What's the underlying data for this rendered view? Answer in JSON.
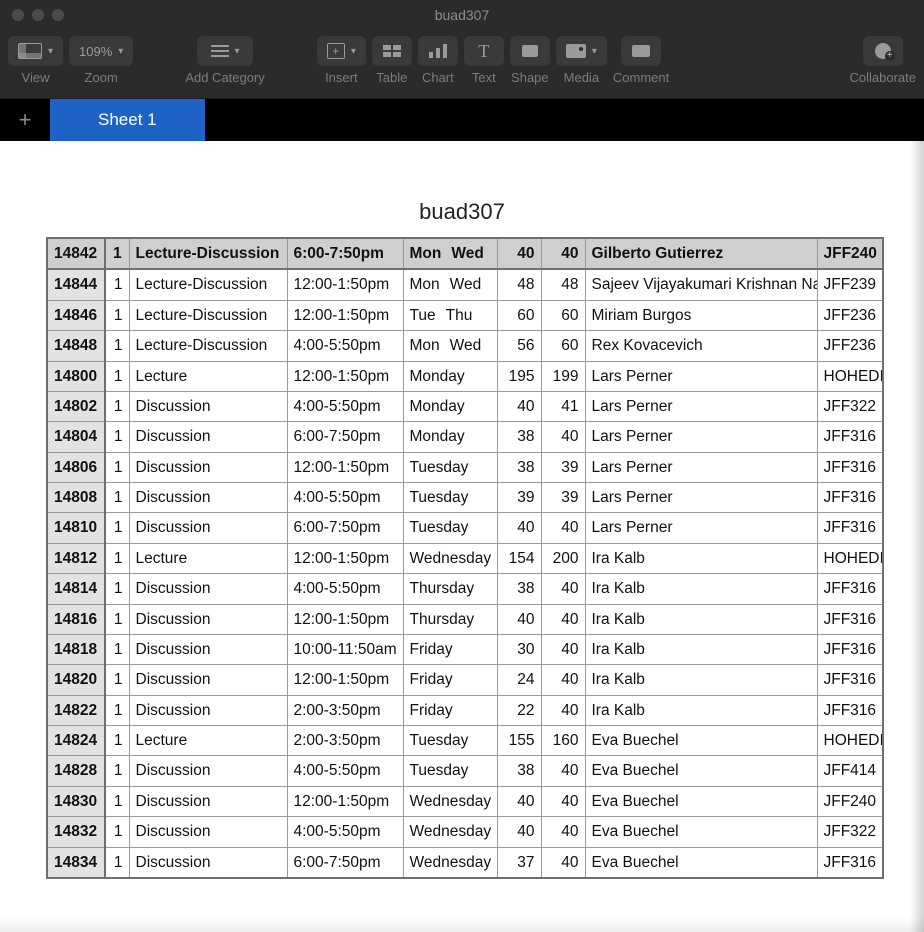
{
  "window": {
    "title": "buad307"
  },
  "toolbar": {
    "view": {
      "label": "View"
    },
    "zoom": {
      "label": "Zoom",
      "value": "109%"
    },
    "add_cat": {
      "label": "Add Category"
    },
    "insert": {
      "label": "Insert"
    },
    "table": {
      "label": "Table"
    },
    "chart": {
      "label": "Chart"
    },
    "text": {
      "label": "Text"
    },
    "shape": {
      "label": "Shape"
    },
    "media": {
      "label": "Media"
    },
    "comment": {
      "label": "Comment"
    },
    "collab": {
      "label": "Collaborate"
    }
  },
  "tabs": {
    "add_glyph": "+",
    "active": "Sheet 1"
  },
  "sheet": {
    "title": "buad307",
    "header": {
      "id": "14842",
      "sec": "1",
      "type": "Lecture-Discussion",
      "time": "6:00-7:50pm",
      "days": [
        "Mon",
        "Wed"
      ],
      "n1": "40",
      "n2": "40",
      "instructor": "Gilberto Gutierrez",
      "room": "JFF240"
    },
    "rows": [
      {
        "id": "14844",
        "sec": "1",
        "type": "Lecture-Discussion",
        "time": "12:00-1:50pm",
        "days": [
          "Mon",
          "Wed"
        ],
        "n1": "48",
        "n2": "48",
        "instructor": "Sajeev Vijayakumari Krishnan Nair",
        "room": "JFF239"
      },
      {
        "id": "14846",
        "sec": "1",
        "type": "Lecture-Discussion",
        "time": "12:00-1:50pm",
        "days": [
          "Tue",
          "Thu"
        ],
        "n1": "60",
        "n2": "60",
        "instructor": "Miriam Burgos",
        "room": "JFF236"
      },
      {
        "id": "14848",
        "sec": "1",
        "type": "Lecture-Discussion",
        "time": "4:00-5:50pm",
        "days": [
          "Mon",
          "Wed"
        ],
        "n1": "56",
        "n2": "60",
        "instructor": "Rex Kovacevich",
        "room": "JFF236"
      },
      {
        "id": "14800",
        "sec": "1",
        "type": "Lecture",
        "time": "12:00-1:50pm",
        "days": [
          "Monday"
        ],
        "n1": "195",
        "n2": "199",
        "instructor": "Lars Perner",
        "room": "HOHEDI"
      },
      {
        "id": "14802",
        "sec": "1",
        "type": "Discussion",
        "time": "4:00-5:50pm",
        "days": [
          "Monday"
        ],
        "n1": "40",
        "n2": "41",
        "instructor": "Lars Perner",
        "room": "JFF322"
      },
      {
        "id": "14804",
        "sec": "1",
        "type": "Discussion",
        "time": "6:00-7:50pm",
        "days": [
          "Monday"
        ],
        "n1": "38",
        "n2": "40",
        "instructor": "Lars Perner",
        "room": "JFF316"
      },
      {
        "id": "14806",
        "sec": "1",
        "type": "Discussion",
        "time": "12:00-1:50pm",
        "days": [
          "Tuesday"
        ],
        "n1": "38",
        "n2": "39",
        "instructor": "Lars Perner",
        "room": "JFF316"
      },
      {
        "id": "14808",
        "sec": "1",
        "type": "Discussion",
        "time": "4:00-5:50pm",
        "days": [
          "Tuesday"
        ],
        "n1": "39",
        "n2": "39",
        "instructor": "Lars Perner",
        "room": "JFF316"
      },
      {
        "id": "14810",
        "sec": "1",
        "type": "Discussion",
        "time": "6:00-7:50pm",
        "days": [
          "Tuesday"
        ],
        "n1": "40",
        "n2": "40",
        "instructor": "Lars Perner",
        "room": "JFF316"
      },
      {
        "id": "14812",
        "sec": "1",
        "type": "Lecture",
        "time": "12:00-1:50pm",
        "days": [
          "Wednesday"
        ],
        "n1": "154",
        "n2": "200",
        "instructor": "Ira Kalb",
        "room": "HOHEDI"
      },
      {
        "id": "14814",
        "sec": "1",
        "type": "Discussion",
        "time": "4:00-5:50pm",
        "days": [
          "Thursday"
        ],
        "n1": "38",
        "n2": "40",
        "instructor": "Ira Kalb",
        "room": "JFF316"
      },
      {
        "id": "14816",
        "sec": "1",
        "type": "Discussion",
        "time": "12:00-1:50pm",
        "days": [
          "Thursday"
        ],
        "n1": "40",
        "n2": "40",
        "instructor": "Ira Kalb",
        "room": "JFF316"
      },
      {
        "id": "14818",
        "sec": "1",
        "type": "Discussion",
        "time": "10:00-11:50am",
        "days": [
          "Friday"
        ],
        "n1": "30",
        "n2": "40",
        "instructor": "Ira Kalb",
        "room": "JFF316"
      },
      {
        "id": "14820",
        "sec": "1",
        "type": "Discussion",
        "time": "12:00-1:50pm",
        "days": [
          "Friday"
        ],
        "n1": "24",
        "n2": "40",
        "instructor": "Ira Kalb",
        "room": "JFF316"
      },
      {
        "id": "14822",
        "sec": "1",
        "type": "Discussion",
        "time": "2:00-3:50pm",
        "days": [
          "Friday"
        ],
        "n1": "22",
        "n2": "40",
        "instructor": "Ira Kalb",
        "room": "JFF316"
      },
      {
        "id": "14824",
        "sec": "1",
        "type": "Lecture",
        "time": "2:00-3:50pm",
        "days": [
          "Tuesday"
        ],
        "n1": "155",
        "n2": "160",
        "instructor": "Eva Buechel",
        "room": "HOHEDI"
      },
      {
        "id": "14828",
        "sec": "1",
        "type": "Discussion",
        "time": "4:00-5:50pm",
        "days": [
          "Tuesday"
        ],
        "n1": "38",
        "n2": "40",
        "instructor": "Eva Buechel",
        "room": "JFF414"
      },
      {
        "id": "14830",
        "sec": "1",
        "type": "Discussion",
        "time": "12:00-1:50pm",
        "days": [
          "Wednesday"
        ],
        "n1": "40",
        "n2": "40",
        "instructor": "Eva Buechel",
        "room": "JFF240"
      },
      {
        "id": "14832",
        "sec": "1",
        "type": "Discussion",
        "time": "4:00-5:50pm",
        "days": [
          "Wednesday"
        ],
        "n1": "40",
        "n2": "40",
        "instructor": "Eva Buechel",
        "room": "JFF322"
      },
      {
        "id": "14834",
        "sec": "1",
        "type": "Discussion",
        "time": "6:00-7:50pm",
        "days": [
          "Wednesday"
        ],
        "n1": "37",
        "n2": "40",
        "instructor": "Eva Buechel",
        "room": "JFF316"
      }
    ]
  }
}
